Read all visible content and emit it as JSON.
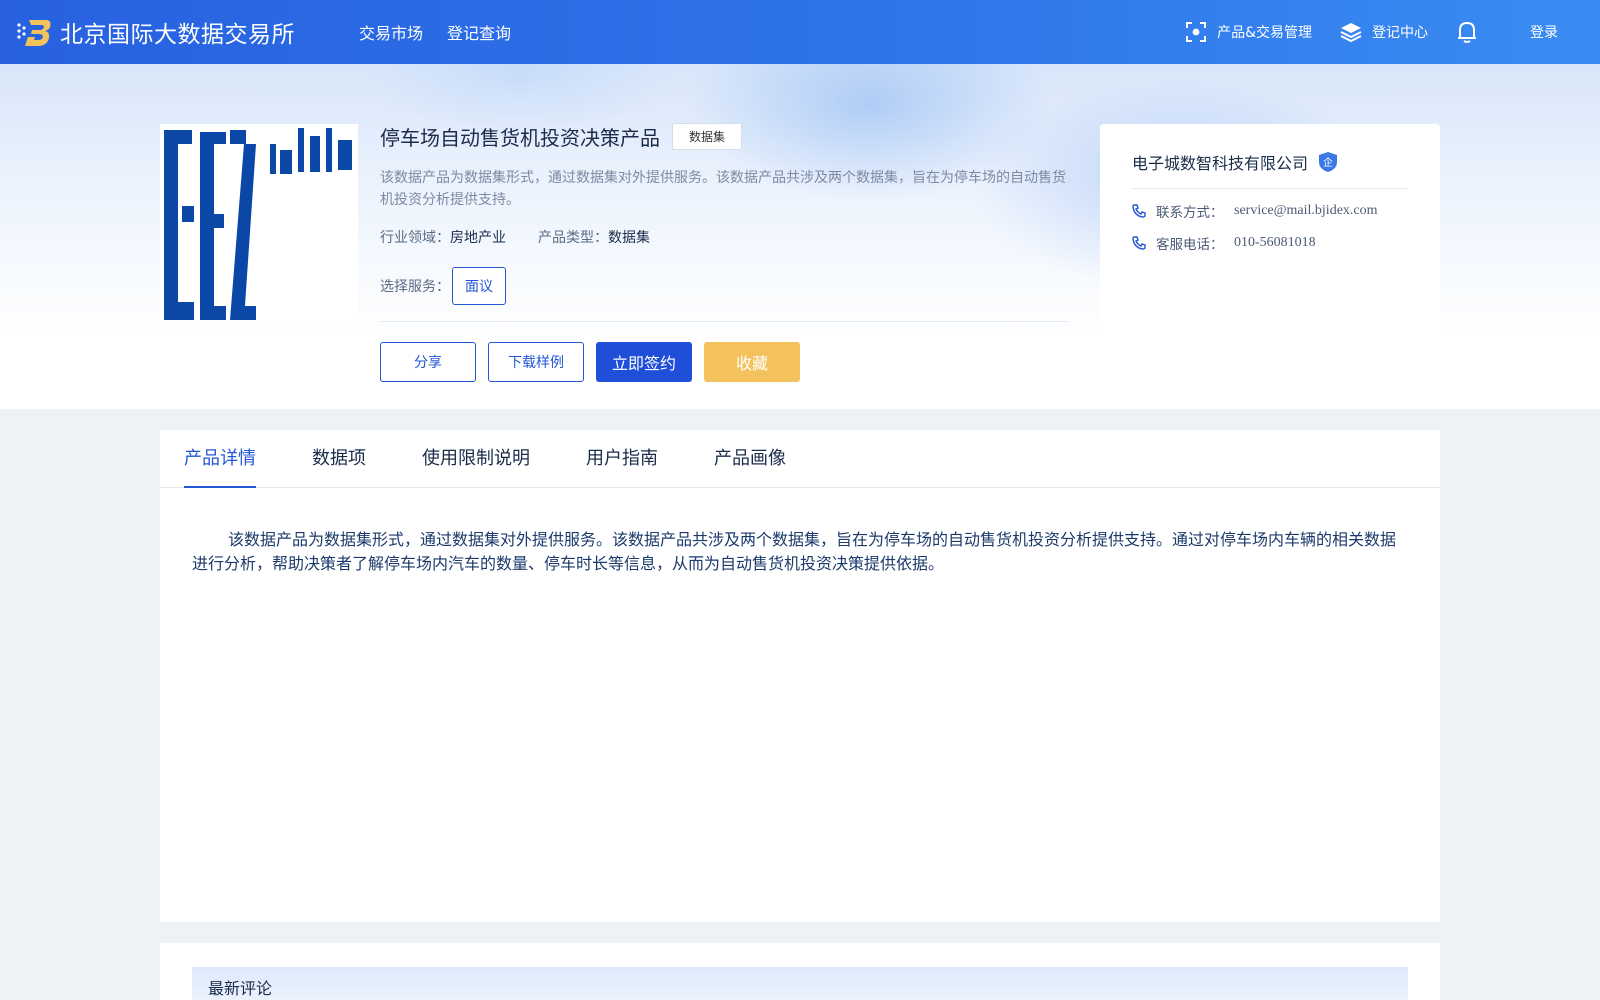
{
  "header": {
    "logo_text": "北京国际大数据交易所",
    "nav": [
      "交易市场",
      "登记查询"
    ],
    "right": {
      "product_mgmt": "产品&交易管理",
      "register_center": "登记中心",
      "login": "登录"
    }
  },
  "product": {
    "title": "停车场自动售货机投资决策产品",
    "tag": "数据集",
    "description": "该数据产品为数据集形式，通过数据集对外提供服务。该数据产品共涉及两个数据集，旨在为停车场的自动售货机投资分析提供支持。",
    "industry_label": "行业领域：",
    "industry_value": "房地产业",
    "type_label": "产品类型：",
    "type_value": "数据集",
    "service_label": "选择服务：",
    "service_option": "面议",
    "buttons": {
      "share": "分享",
      "download": "下载样例",
      "sign": "立即签约",
      "favorite": "收藏"
    }
  },
  "company": {
    "name": "电子城数智科技有限公司",
    "badge": "企",
    "contact_label": "联系方式：",
    "contact_value": "service@mail.bjidex.com",
    "phone_label": "客服电话：",
    "phone_value": "010-56081018"
  },
  "tabs": [
    "产品详情",
    "数据项",
    "使用限制说明",
    "用户指南",
    "产品画像"
  ],
  "detail_text": "该数据产品为数据集形式，通过数据集对外提供服务。该数据产品共涉及两个数据集，旨在为停车场的自动售货机投资分析提供支持。通过对停车场内车辆的相关数据进行分析，帮助决策者了解停车场内汽车的数量、停车时长等信息，从而为自动售货机投资决策提供依据。",
  "comments": {
    "title": "最新评论"
  },
  "colors": {
    "brand": "#2761e0",
    "primary_button": "#1f4fd8",
    "favorite_button": "#f4c25c",
    "active_tab": "#2356d4"
  }
}
